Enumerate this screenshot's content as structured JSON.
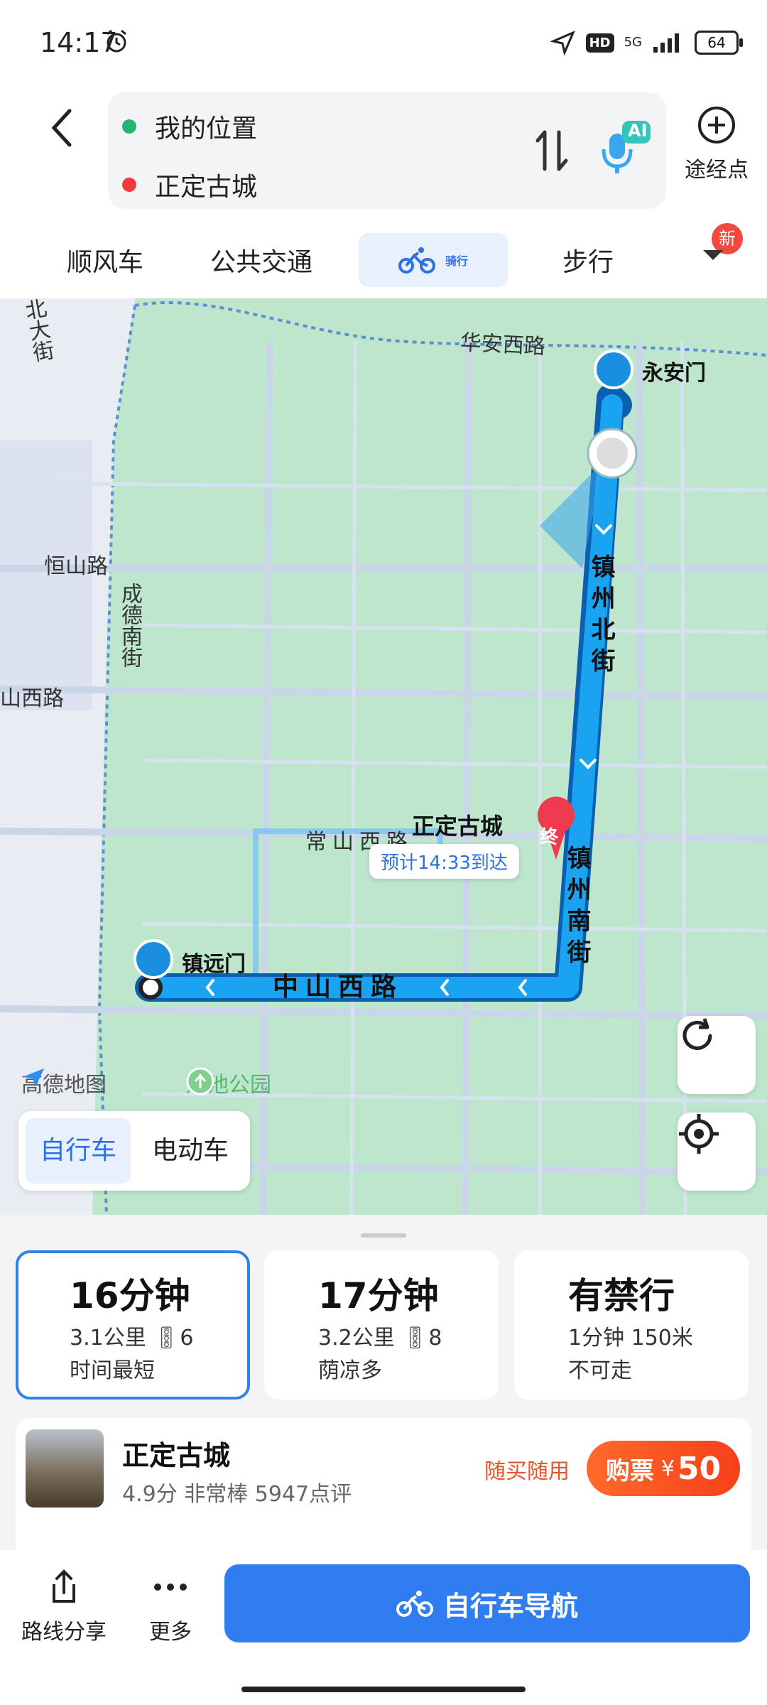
{
  "status_bar": {
    "time": "14:17",
    "network": "5G",
    "hd": "HD",
    "battery": "64"
  },
  "route": {
    "origin": "我的位置",
    "destination": "正定古城",
    "origin_color": "#22b573",
    "destination_color": "#ef3b3b"
  },
  "header": {
    "via_label": "途经点",
    "ai_badge": "AI"
  },
  "modes": [
    {
      "label": "顺风车"
    },
    {
      "label": "公共交通"
    },
    {
      "label": "骑行"
    },
    {
      "label": "步行"
    }
  ],
  "new_badge": "新",
  "map": {
    "labels": {
      "huaan": "华安西路",
      "yongan": "永安门",
      "hengshan": "恒山路",
      "chengde": "成德南街",
      "shanxi": "山西路",
      "beidajie": "北大街",
      "changshan": "常山西路",
      "zhengzhou_n": "镇州北街",
      "zhengzhou_s": "镇州南街",
      "zhongshan": "中山西路",
      "zhenyuan": "镇远门",
      "dest": "正定古城",
      "end_marker": "终",
      "eta": "预计14:33到达",
      "gaode": "高德地图",
      "lianchi": "莲池公园"
    },
    "vehicle_options": [
      "自行车",
      "电动车"
    ],
    "colors": {
      "route": "#1aa3f0",
      "park": "#bde6cc"
    }
  },
  "routes": [
    {
      "time": "16分钟",
      "distance": "3.1公里",
      "lights": "6",
      "note": "时间最短"
    },
    {
      "time": "17分钟",
      "distance": "3.2公里",
      "lights": "8",
      "note": "荫凉多"
    },
    {
      "time": "有禁行",
      "distance": "1分钟 150米",
      "lights": "",
      "note": "不可走"
    }
  ],
  "poi": {
    "name": "正定古城",
    "meta": "4.9分 非常棒 5947点评",
    "tag": "随买随用",
    "button": "购票",
    "currency": "¥",
    "price": "50"
  },
  "bottom": {
    "share": "路线分享",
    "more": "更多",
    "navigate": "自行车导航"
  }
}
